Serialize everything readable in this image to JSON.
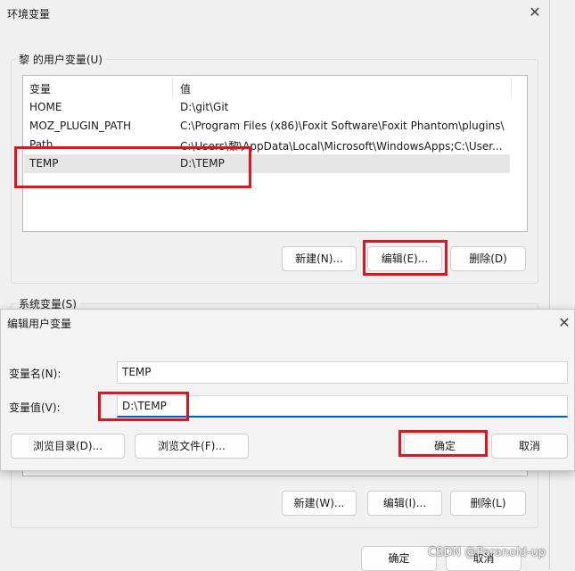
{
  "env_window": {
    "title": "环境变量",
    "user_group_label": "黎 的用户变量(U)",
    "columns": [
      "变量",
      "值"
    ],
    "rows": [
      {
        "name": "HOME",
        "value": "D:\\git\\Git"
      },
      {
        "name": "MOZ_PLUGIN_PATH",
        "value": "C:\\Program Files (x86)\\Foxit Software\\Foxit Phantom\\plugins\\"
      },
      {
        "name": "Path",
        "value": "C:\\Users\\黎\\AppData\\Local\\Microsoft\\WindowsApps;C:\\User..."
      },
      {
        "name": "TEMP",
        "value": "D:\\TEMP"
      }
    ],
    "user_buttons": {
      "new": "新建(N)...",
      "edit": "编辑(E)...",
      "delete": "删除(D)"
    },
    "system_group_label": "系统变量(S)",
    "system_buttons": {
      "new": "新建(W)...",
      "edit": "编辑(I)...",
      "delete": "删除(L)"
    },
    "ok": "确定",
    "cancel": "取消"
  },
  "edit_dialog": {
    "title": "编辑用户变量",
    "name_label": "变量名(N):",
    "name_value": "TEMP",
    "value_label": "变量值(V):",
    "value_value": "D:\\TEMP",
    "browse_dir": "浏览目录(D)...",
    "browse_file": "浏览文件(F)...",
    "ok": "确定",
    "cancel": "取消"
  },
  "watermark": "CSDN @Paranoid-up",
  "colors": {
    "highlight_red": "#e0141e",
    "focus_blue": "#005fb8"
  }
}
